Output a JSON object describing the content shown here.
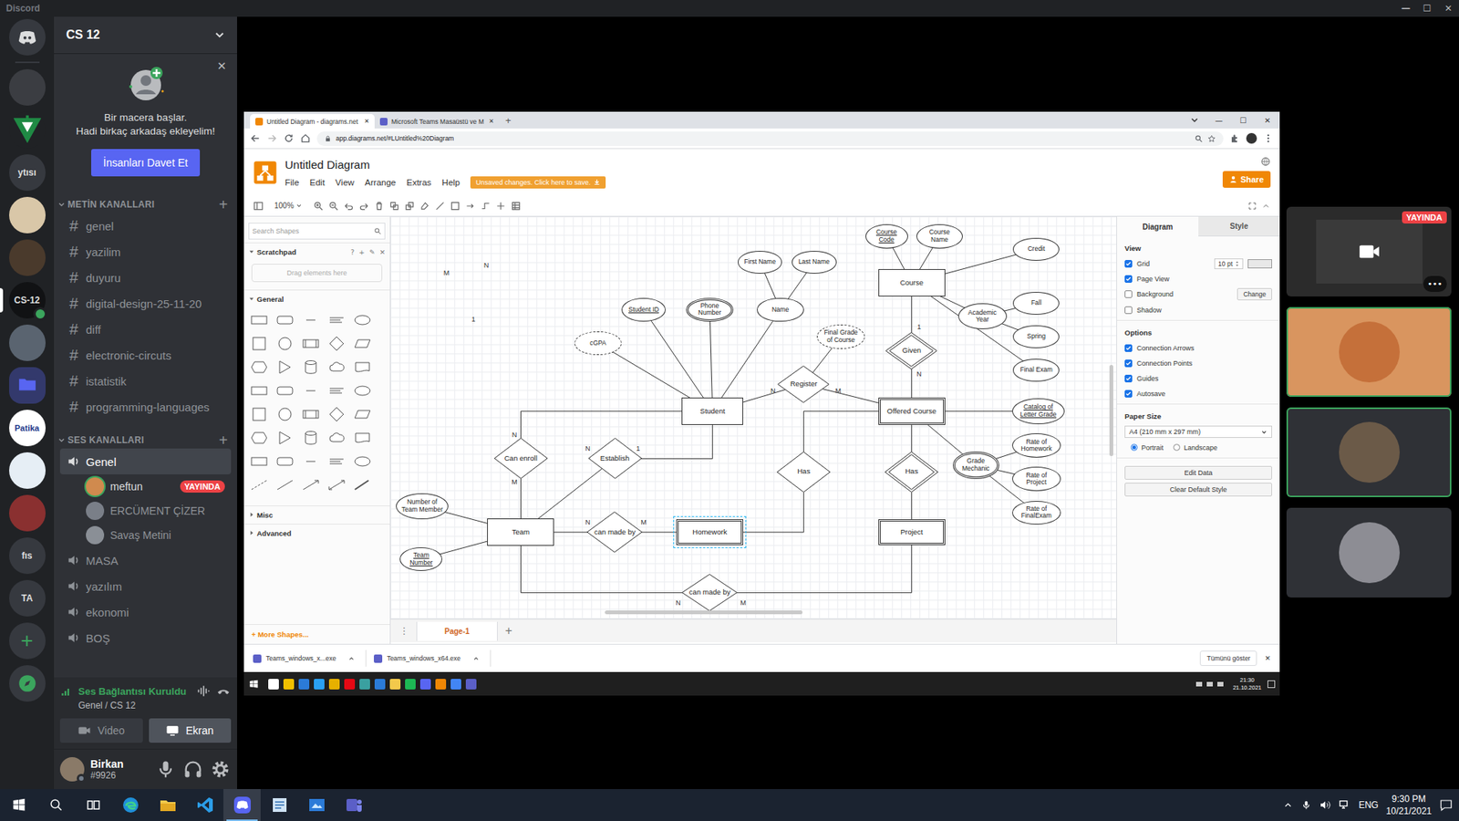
{
  "window": {
    "title": "Discord",
    "controls": [
      "—",
      "☐",
      "✕"
    ]
  },
  "servers": [
    {
      "kind": "discord",
      "selected": false,
      "badge": false
    },
    {
      "kind": "photo",
      "color": "#3b3d42",
      "selected": false,
      "badge": false
    },
    {
      "kind": "emblem",
      "color": "#1f8a44",
      "selected": false,
      "badge": false
    },
    {
      "kind": "text",
      "label": "ytısı",
      "color": "#36393f",
      "selected": false,
      "badge": false
    },
    {
      "kind": "photo",
      "color": "#d9c7a8",
      "selected": false,
      "badge": false
    },
    {
      "kind": "photo",
      "color": "#4a3a2c",
      "selected": false,
      "badge": false
    },
    {
      "kind": "text",
      "label": "CS-12",
      "color": "#111214",
      "selected": true,
      "badge": true
    },
    {
      "kind": "photo",
      "color": "#5a6470",
      "selected": false,
      "badge": false
    },
    {
      "kind": "folder",
      "color": "#5865f2",
      "selected": false,
      "badge": false
    },
    {
      "kind": "text",
      "label": "Patika",
      "color": "#ffffff",
      "selected": false,
      "badge": false
    },
    {
      "kind": "photo",
      "color": "#e6eef5",
      "selected": false,
      "badge": false
    },
    {
      "kind": "photo",
      "color": "#8a3030",
      "selected": false,
      "badge": false
    },
    {
      "kind": "text",
      "label": "fıs",
      "color": "#36393f",
      "selected": false,
      "badge": false
    },
    {
      "kind": "text",
      "label": "TA",
      "color": "#36393f",
      "selected": false,
      "badge": false
    },
    {
      "kind": "add",
      "label": "+",
      "selected": false,
      "badge": false
    },
    {
      "kind": "explore",
      "selected": false,
      "badge": false
    }
  ],
  "channel_sidebar": {
    "server_name": "CS 12",
    "invite": {
      "line1": "Bir macera başlar.",
      "line2": "Hadi birkaç arkadaş ekleyelim!",
      "button": "İnsanları Davet Et",
      "close": "✕"
    },
    "text_category": {
      "label": "METİN KANALLARI",
      "add": "+",
      "expanded": true
    },
    "text_channels": [
      {
        "prefix": "#",
        "name": "genel"
      },
      {
        "prefix": "#",
        "name": "yazilim"
      },
      {
        "prefix": "#",
        "name": "duyuru"
      },
      {
        "prefix": "#",
        "name": "digital-design-25-11-20"
      },
      {
        "prefix": "#",
        "name": "diff"
      },
      {
        "prefix": "#",
        "name": "electronic-circuts"
      },
      {
        "prefix": "#",
        "name": "istatistik"
      },
      {
        "prefix": "#",
        "name": "programming-languages"
      }
    ],
    "voice_category": {
      "label": "SES KANALLARI",
      "add": "+",
      "expanded": true
    },
    "voice_channels": [
      {
        "name": "Genel",
        "selected": true,
        "users": [
          {
            "name": "meftun",
            "badge": "YAYINDA",
            "speaking": true
          },
          {
            "name": "ERCÜMENT ÇİZER",
            "speaking": false
          },
          {
            "name": "Savaş Metini",
            "speaking": false
          }
        ]
      },
      {
        "name": "MASA",
        "selected": false,
        "users": []
      },
      {
        "name": "yazılım",
        "selected": false,
        "users": []
      },
      {
        "name": "ekonomi",
        "selected": false,
        "users": []
      },
      {
        "name": "BOŞ",
        "selected": false,
        "users": []
      }
    ],
    "voice_panel": {
      "status": "Ses Bağlantısı Kuruldu",
      "location": "Genel / CS 12",
      "buttons": [
        {
          "label": "Video",
          "selected": false
        },
        {
          "label": "Ekran",
          "selected": true
        }
      ]
    },
    "user": {
      "name": "Birkan",
      "tag": "#9926"
    }
  },
  "stream": {
    "browser": {
      "tabs": [
        {
          "label": "Untitled Diagram - diagrams.net",
          "close": "✕",
          "selected": true
        },
        {
          "label": "Microsoft Teams Masaüstü ve M",
          "close": "✕",
          "selected": false
        }
      ],
      "new_tab": "+",
      "controls": [
        "—",
        "☐",
        "✕"
      ],
      "url": "app.diagrams.net/#LUntitled%20Diagram"
    },
    "app": {
      "title": "Untitled Diagram",
      "menus": [
        "File",
        "Edit",
        "View",
        "Arrange",
        "Extras",
        "Help"
      ],
      "unsaved": "Unsaved changes. Click here to save.",
      "share": "Share",
      "zoom": "100%"
    },
    "shapes": {
      "search": "Search Shapes",
      "scratch_tools": [
        "?",
        "+",
        "✎",
        "✕"
      ],
      "drop": "Drag elements here",
      "sections": [
        {
          "label": "Scratchpad",
          "expanded": true
        },
        {
          "label": "General",
          "expanded": true
        },
        {
          "label": "Misc",
          "expanded": false
        },
        {
          "label": "Advanced",
          "expanded": false
        }
      ],
      "more": "+ More Shapes..."
    },
    "format": {
      "tabs": [
        {
          "label": "Diagram",
          "selected": true
        },
        {
          "label": "Style",
          "selected": false
        }
      ],
      "sections": [
        {
          "title": "View",
          "rows": [
            {
              "label": "Grid",
              "checked": true,
              "value": "10 pt"
            },
            {
              "label": "Page View",
              "checked": true
            },
            {
              "label": "Background",
              "checked": false,
              "button": "Change"
            },
            {
              "label": "Shadow",
              "checked": false
            }
          ]
        },
        {
          "title": "Options",
          "rows": [
            {
              "label": "Connection Arrows",
              "checked": true
            },
            {
              "label": "Connection Points",
              "checked": true
            },
            {
              "label": "Guides",
              "checked": true
            },
            {
              "label": "Autosave",
              "checked": true
            }
          ]
        }
      ],
      "paper": {
        "title": "Paper Size",
        "value": "A4 (210 mm x 297 mm)",
        "orientation": [
          {
            "label": "Portrait",
            "selected": true
          },
          {
            "label": "Landscape",
            "selected": false
          }
        ]
      },
      "buttons": [
        "Edit Data",
        "Clear Default Style"
      ]
    },
    "diagram": {
      "nodes": [
        {
          "label": "Course",
          "kind": "entity",
          "selected": false
        },
        {
          "label": "Course\nCode",
          "kind": "key-attribute",
          "selected": false
        },
        {
          "label": "Course\nName",
          "kind": "attribute",
          "selected": false
        },
        {
          "label": "Credit",
          "kind": "attribute",
          "selected": false
        },
        {
          "label": "Academic\nYear",
          "kind": "attribute",
          "selected": false
        },
        {
          "label": "Fall",
          "kind": "attribute",
          "selected": false
        },
        {
          "label": "Spring",
          "kind": "attribute",
          "selected": false
        },
        {
          "label": "Final Exam",
          "kind": "attribute",
          "selected": false
        },
        {
          "label": "Given",
          "kind": "identifying-relationship",
          "selected": false
        },
        {
          "label": "Offered Course",
          "kind": "weak-entity",
          "selected": false
        },
        {
          "label": "Register",
          "kind": "relationship",
          "selected": false
        },
        {
          "label": "Final Grade\nof Course",
          "kind": "derived-attribute",
          "selected": false
        },
        {
          "label": "Student",
          "kind": "entity",
          "selected": false
        },
        {
          "label": "Student ID",
          "kind": "key-attribute",
          "selected": false
        },
        {
          "label": "Phone\nNumber",
          "kind": "multivalued-attribute",
          "selected": false
        },
        {
          "label": "Name",
          "kind": "attribute",
          "selected": false
        },
        {
          "label": "First Name",
          "kind": "attribute",
          "selected": false
        },
        {
          "label": "Last Name",
          "kind": "attribute",
          "selected": false
        },
        {
          "label": "cGPA",
          "kind": "derived-attribute",
          "selected": false
        },
        {
          "label": "Catalog of\nLetter Grade",
          "kind": "key-attribute",
          "selected": false
        },
        {
          "label": "Grade\nMechanic",
          "kind": "multivalued-attribute",
          "selected": false
        },
        {
          "label": "Rate of\nHomework",
          "kind": "attribute",
          "selected": false
        },
        {
          "label": "Rate of\nProject",
          "kind": "attribute",
          "selected": false
        },
        {
          "label": "Rate of\nFinalExam",
          "kind": "attribute",
          "selected": false
        },
        {
          "label": "Can enroll",
          "kind": "relationship",
          "selected": false
        },
        {
          "label": "Establish",
          "kind": "relationship",
          "selected": false
        },
        {
          "label": "Team",
          "kind": "entity",
          "selected": false
        },
        {
          "label": "Number of\nTeam Member",
          "kind": "attribute",
          "selected": false
        },
        {
          "label": "Team\nNumber",
          "kind": "key-attribute",
          "selected": false
        },
        {
          "label": "can made by",
          "kind": "relationship",
          "selected": false
        },
        {
          "label": "Homework",
          "kind": "weak-entity",
          "selected": true
        },
        {
          "label": "Has",
          "kind": "relationship",
          "selected": false
        },
        {
          "label": "Has",
          "kind": "identifying-relationship",
          "selected": false
        },
        {
          "label": "Project",
          "kind": "weak-entity",
          "selected": false
        },
        {
          "label": "can made by",
          "kind": "relationship",
          "selected": false
        }
      ],
      "edges": [
        {
          "from": 0,
          "to": 1,
          "kind": "straight"
        },
        {
          "from": 0,
          "to": 2,
          "kind": "straight"
        },
        {
          "from": 0,
          "to": 3,
          "kind": "straight"
        },
        {
          "from": 0,
          "to": 4,
          "kind": "straight"
        },
        {
          "from": 4,
          "to": 5,
          "kind": "straight"
        },
        {
          "from": 4,
          "to": 6,
          "kind": "straight"
        },
        {
          "from": 0,
          "to": 7,
          "kind": "straight"
        },
        {
          "from": 0,
          "to": 8,
          "kind": "straight"
        },
        {
          "from": 8,
          "to": 9,
          "kind": "straight"
        },
        {
          "from": 12,
          "to": 10,
          "kind": "straight"
        },
        {
          "from": 10,
          "to": 9,
          "kind": "straight"
        },
        {
          "from": 10,
          "to": 11,
          "kind": "straight"
        },
        {
          "from": 12,
          "to": 13,
          "kind": "straight"
        },
        {
          "from": 12,
          "to": 14,
          "kind": "straight"
        },
        {
          "from": 12,
          "to": 15,
          "kind": "straight"
        },
        {
          "from": 15,
          "to": 16,
          "kind": "straight"
        },
        {
          "from": 15,
          "to": 17,
          "kind": "straight"
        },
        {
          "from": 12,
          "to": 18,
          "kind": "straight"
        },
        {
          "from": 9,
          "to": 19,
          "kind": "straight"
        },
        {
          "from": 9,
          "to": 20,
          "kind": "straight"
        },
        {
          "from": 20,
          "to": 21,
          "kind": "straight"
        },
        {
          "from": 20,
          "to": 22,
          "kind": "straight"
        },
        {
          "from": 20,
          "to": 23,
          "kind": "straight"
        },
        {
          "from": 12,
          "to": 24,
          "kind": "hv"
        },
        {
          "from": 24,
          "to": 26,
          "kind": "straight"
        },
        {
          "from": 12,
          "to": 25,
          "kind": "vh"
        },
        {
          "from": 25,
          "to": 26,
          "kind": "straight"
        },
        {
          "from": 26,
          "to": 27,
          "kind": "straight"
        },
        {
          "from": 26,
          "to": 28,
          "kind": "straight"
        },
        {
          "from": 26,
          "to": 29,
          "kind": "straight"
        },
        {
          "from": 29,
          "to": 30,
          "kind": "straight"
        },
        {
          "from": 30,
          "to": 31,
          "kind": "hv"
        },
        {
          "from": 31,
          "to": 9,
          "kind": "vh"
        },
        {
          "from": 9,
          "to": 32,
          "kind": "straight"
        },
        {
          "from": 32,
          "to": 33,
          "kind": "straight"
        },
        {
          "from": 26,
          "to": 34,
          "kind": "vh"
        },
        {
          "from": 34,
          "to": 33,
          "kind": "hv"
        }
      ],
      "labels": [
        "M",
        "N",
        "1",
        "1",
        "N",
        "N",
        "M",
        "N",
        "M",
        "N",
        "1",
        "N",
        "M",
        "N",
        "M"
      ]
    },
    "pages": {
      "menu": "⋮",
      "tabs": [
        {
          "label": "Page-1",
          "selected": true
        }
      ],
      "add": "+"
    },
    "downloads": {
      "items": [
        {
          "label": "Teams_windows_x...exe"
        },
        {
          "label": "Teams_windows_x64.exe"
        }
      ],
      "show_all": "Tümünü göster",
      "close": "✕"
    },
    "taskbar": {
      "time": "21:30",
      "date": "21.10.2021"
    }
  },
  "tiles": [
    {
      "kind": "screen",
      "badge": "YAYINDA",
      "more": "•••",
      "speaking": false
    },
    {
      "kind": "avatar",
      "color": "#d9955f",
      "speaking": true
    },
    {
      "kind": "avatar",
      "color": "#2f3136",
      "speaking": true
    },
    {
      "kind": "avatar",
      "color": "#2f3136",
      "speaking": false
    }
  ],
  "os_taskbar": {
    "apps": [
      {
        "kind": "edge",
        "selected": false
      },
      {
        "kind": "explorer",
        "selected": false
      },
      {
        "kind": "vscode",
        "selected": false
      },
      {
        "kind": "discord",
        "selected": true
      },
      {
        "kind": "notepad",
        "selected": false
      },
      {
        "kind": "paint",
        "selected": false
      },
      {
        "kind": "teams",
        "selected": false
      }
    ],
    "lang": "ENG",
    "time": "9:30 PM",
    "date": "10/21/2021"
  }
}
